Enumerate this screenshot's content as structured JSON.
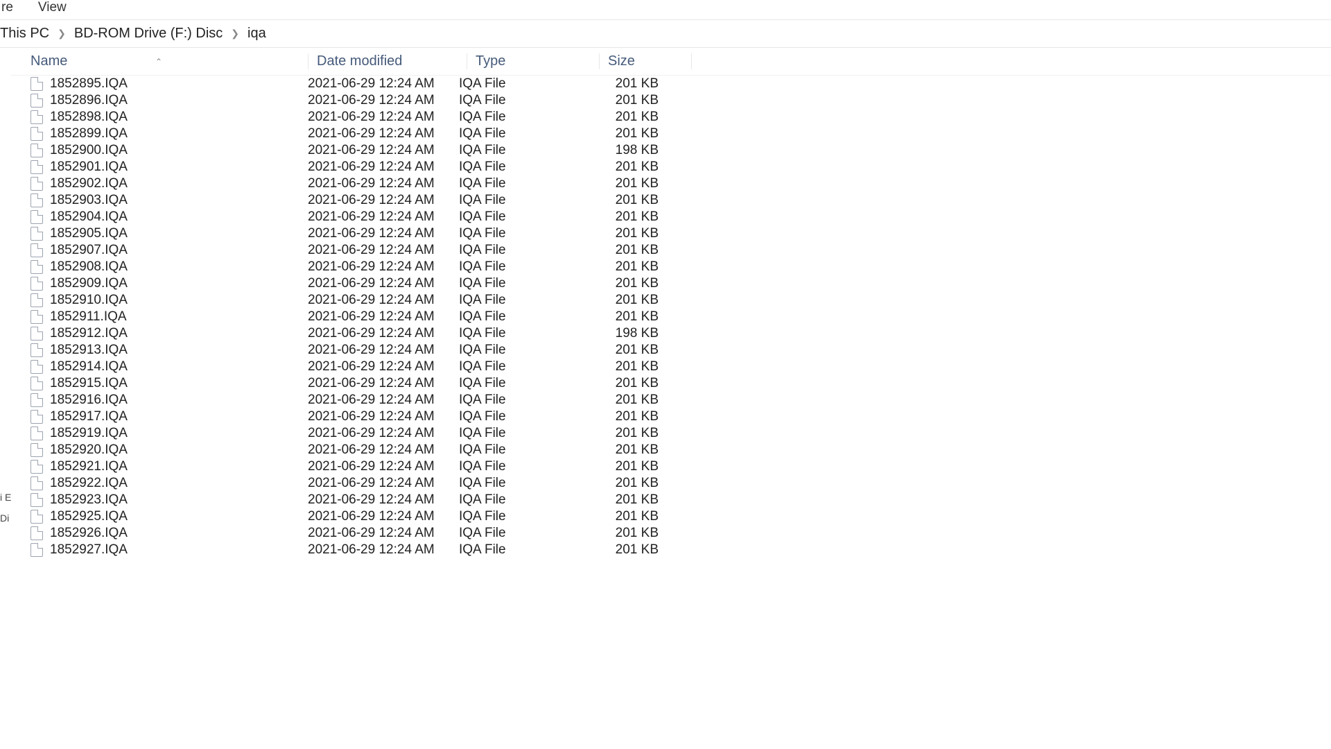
{
  "ribbon": {
    "tab1": "re",
    "tab2": "View"
  },
  "breadcrumb": {
    "c1": "This PC",
    "c2": "BD-ROM Drive (F:) Disc",
    "c3": "iqa"
  },
  "headers": {
    "name": "Name",
    "date": "Date modified",
    "type": "Type",
    "size": "Size"
  },
  "navstub": {
    "a": "",
    "b": "",
    "c": "",
    "d": "",
    "e": "i E",
    "f": "Di"
  },
  "rows": [
    {
      "name": "1852895.IQA",
      "date": "2021-06-29 12:24 AM",
      "type": "IQA File",
      "size": "201 KB"
    },
    {
      "name": "1852896.IQA",
      "date": "2021-06-29 12:24 AM",
      "type": "IQA File",
      "size": "201 KB"
    },
    {
      "name": "1852898.IQA",
      "date": "2021-06-29 12:24 AM",
      "type": "IQA File",
      "size": "201 KB"
    },
    {
      "name": "1852899.IQA",
      "date": "2021-06-29 12:24 AM",
      "type": "IQA File",
      "size": "201 KB"
    },
    {
      "name": "1852900.IQA",
      "date": "2021-06-29 12:24 AM",
      "type": "IQA File",
      "size": "198 KB"
    },
    {
      "name": "1852901.IQA",
      "date": "2021-06-29 12:24 AM",
      "type": "IQA File",
      "size": "201 KB"
    },
    {
      "name": "1852902.IQA",
      "date": "2021-06-29 12:24 AM",
      "type": "IQA File",
      "size": "201 KB"
    },
    {
      "name": "1852903.IQA",
      "date": "2021-06-29 12:24 AM",
      "type": "IQA File",
      "size": "201 KB"
    },
    {
      "name": "1852904.IQA",
      "date": "2021-06-29 12:24 AM",
      "type": "IQA File",
      "size": "201 KB"
    },
    {
      "name": "1852905.IQA",
      "date": "2021-06-29 12:24 AM",
      "type": "IQA File",
      "size": "201 KB"
    },
    {
      "name": "1852907.IQA",
      "date": "2021-06-29 12:24 AM",
      "type": "IQA File",
      "size": "201 KB"
    },
    {
      "name": "1852908.IQA",
      "date": "2021-06-29 12:24 AM",
      "type": "IQA File",
      "size": "201 KB"
    },
    {
      "name": "1852909.IQA",
      "date": "2021-06-29 12:24 AM",
      "type": "IQA File",
      "size": "201 KB"
    },
    {
      "name": "1852910.IQA",
      "date": "2021-06-29 12:24 AM",
      "type": "IQA File",
      "size": "201 KB"
    },
    {
      "name": "1852911.IQA",
      "date": "2021-06-29 12:24 AM",
      "type": "IQA File",
      "size": "201 KB"
    },
    {
      "name": "1852912.IQA",
      "date": "2021-06-29 12:24 AM",
      "type": "IQA File",
      "size": "198 KB"
    },
    {
      "name": "1852913.IQA",
      "date": "2021-06-29 12:24 AM",
      "type": "IQA File",
      "size": "201 KB"
    },
    {
      "name": "1852914.IQA",
      "date": "2021-06-29 12:24 AM",
      "type": "IQA File",
      "size": "201 KB"
    },
    {
      "name": "1852915.IQA",
      "date": "2021-06-29 12:24 AM",
      "type": "IQA File",
      "size": "201 KB"
    },
    {
      "name": "1852916.IQA",
      "date": "2021-06-29 12:24 AM",
      "type": "IQA File",
      "size": "201 KB"
    },
    {
      "name": "1852917.IQA",
      "date": "2021-06-29 12:24 AM",
      "type": "IQA File",
      "size": "201 KB"
    },
    {
      "name": "1852919.IQA",
      "date": "2021-06-29 12:24 AM",
      "type": "IQA File",
      "size": "201 KB"
    },
    {
      "name": "1852920.IQA",
      "date": "2021-06-29 12:24 AM",
      "type": "IQA File",
      "size": "201 KB"
    },
    {
      "name": "1852921.IQA",
      "date": "2021-06-29 12:24 AM",
      "type": "IQA File",
      "size": "201 KB"
    },
    {
      "name": "1852922.IQA",
      "date": "2021-06-29 12:24 AM",
      "type": "IQA File",
      "size": "201 KB"
    },
    {
      "name": "1852923.IQA",
      "date": "2021-06-29 12:24 AM",
      "type": "IQA File",
      "size": "201 KB"
    },
    {
      "name": "1852925.IQA",
      "date": "2021-06-29 12:24 AM",
      "type": "IQA File",
      "size": "201 KB"
    },
    {
      "name": "1852926.IQA",
      "date": "2021-06-29 12:24 AM",
      "type": "IQA File",
      "size": "201 KB"
    },
    {
      "name": "1852927.IQA",
      "date": "2021-06-29 12:24 AM",
      "type": "IQA File",
      "size": "201 KB"
    }
  ]
}
